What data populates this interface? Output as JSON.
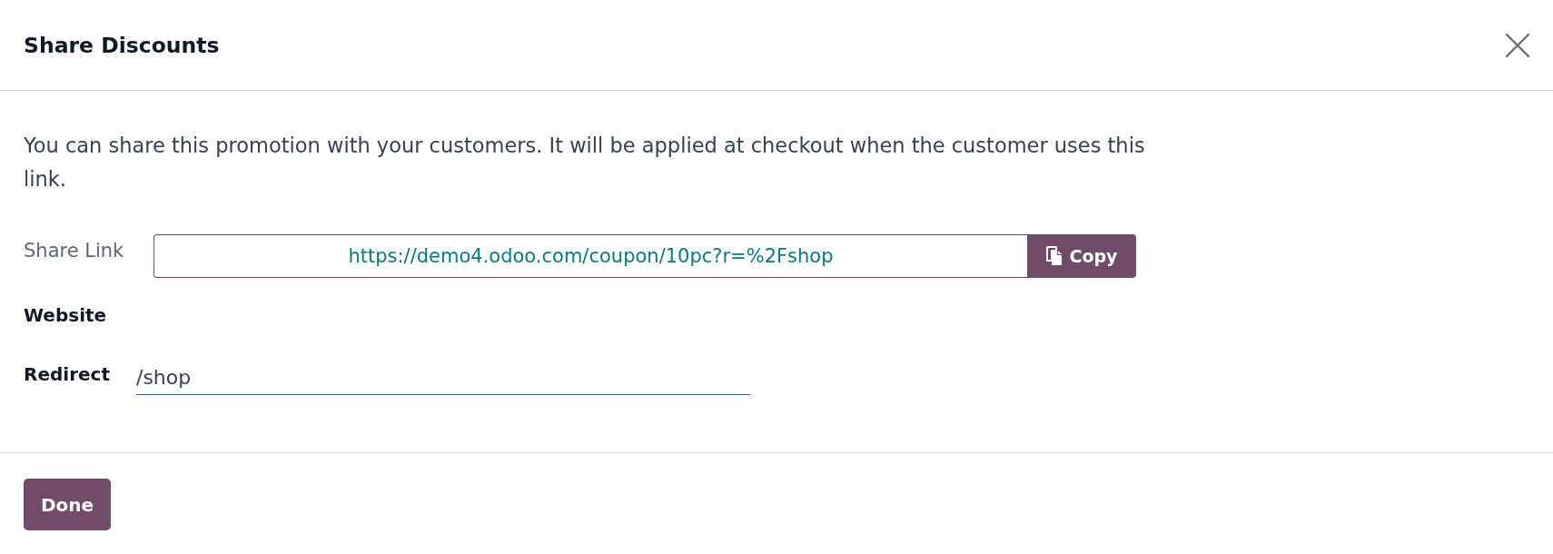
{
  "dialog": {
    "title": "Share Discounts"
  },
  "body": {
    "message": "You can share this promotion with your customers. It will be applied at checkout when the customer uses this link.",
    "fields": [
      {
        "kind": "link",
        "label": "Share Link",
        "value": "https://demo4.odoo.com/coupon/10pc?r=%2Fshop",
        "button": "Copy"
      },
      {
        "kind": "heading",
        "label": "Website"
      },
      {
        "kind": "input",
        "label": "Redirect",
        "value": "/shop"
      }
    ]
  },
  "footer": {
    "buttons": [
      "Done"
    ]
  }
}
